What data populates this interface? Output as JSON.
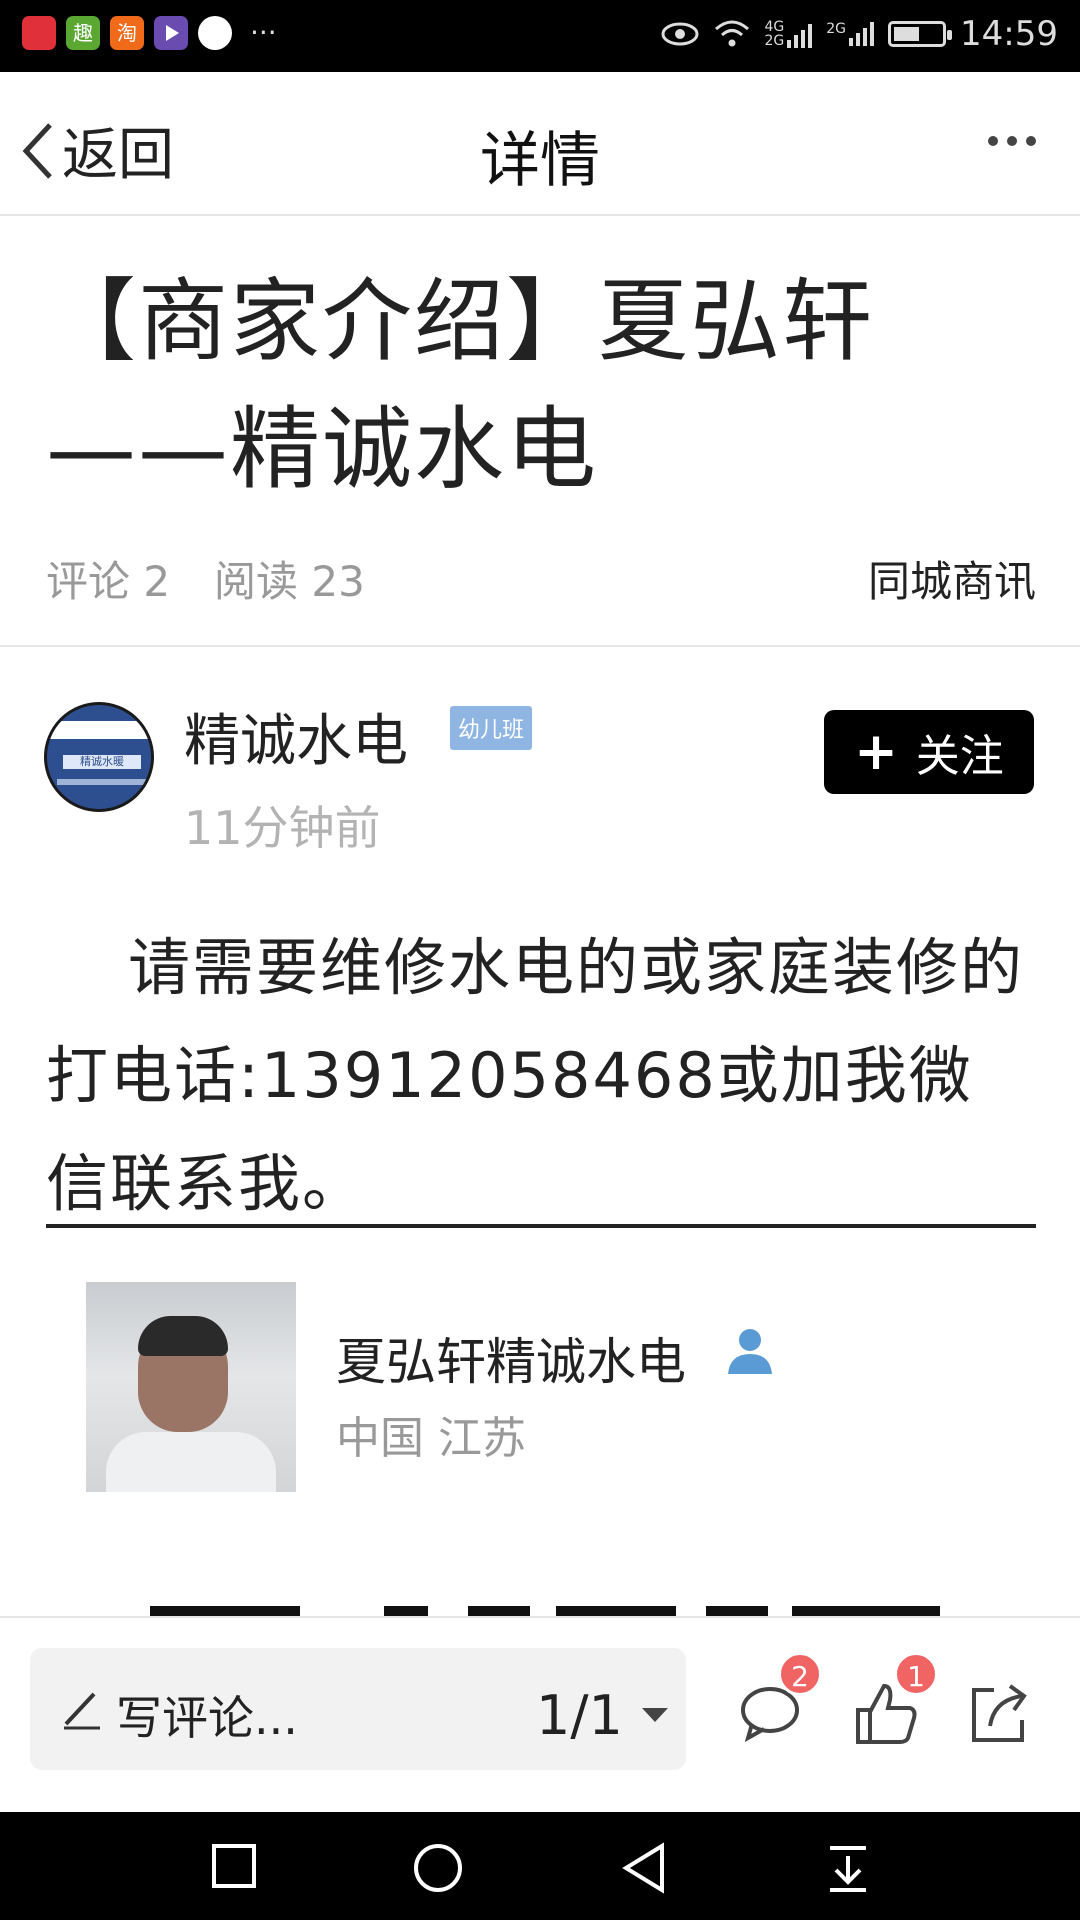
{
  "status_bar": {
    "time": "14:59",
    "network_top": "4G",
    "network_bottom": "2G",
    "network2": "2G",
    "battery_level": 0.55,
    "app_icons": [
      "red-app-icon",
      "green-app-icon",
      "taobao-app-icon",
      "purple-app-icon",
      "white-circle-app-icon"
    ],
    "app_icon_colors": [
      "#e0303a",
      "#5aa832",
      "#f06a1a",
      "#6a4bb0",
      "#ffffff"
    ],
    "taobao_label": "淘",
    "green_label": "趣",
    "more": "···"
  },
  "navbar": {
    "back_label": "返回",
    "title": "详情"
  },
  "article": {
    "title": "【商家介绍】夏弘轩——精诚水电",
    "comments_label": "评论 2",
    "reads_label": "阅读 23",
    "category": "同城商讯",
    "body": "请需要维修水电的或家庭装修的打电话:13912058468或加我微信联系我。"
  },
  "author": {
    "name": "精诚水电",
    "badge": "幼儿班",
    "time": "11分钟前",
    "follow_label": "关注",
    "follow_plus": "+",
    "avatar_text": "精诚水暖"
  },
  "profile_card": {
    "name": "夏弘轩精诚水电",
    "location": "中国 江苏"
  },
  "bottom_bar": {
    "comment_placeholder": "写评论...",
    "page_indicator": "1/1",
    "comment_count": "2",
    "like_count": "1"
  },
  "colors": {
    "badge_red": "#f06464",
    "author_badge_blue": "#8fb6e3",
    "follow_button": "#000000"
  }
}
